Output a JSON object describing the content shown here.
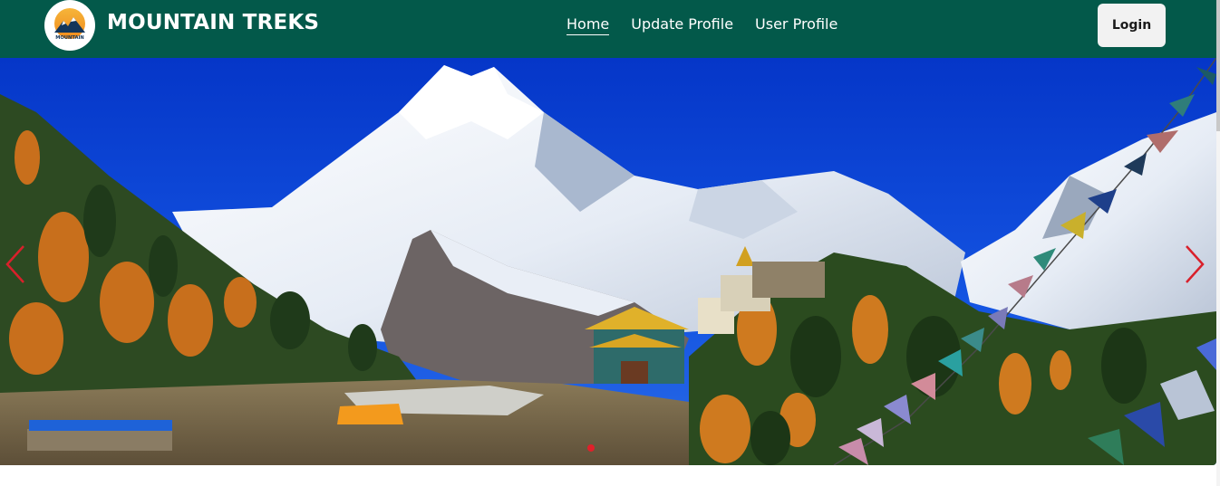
{
  "brand": {
    "name": "MOUNTAIN TREKS",
    "logo_text": "MOUNTAIN"
  },
  "nav": {
    "links": [
      {
        "label": "Home",
        "active": true
      },
      {
        "label": "Update Profile",
        "active": false
      },
      {
        "label": "User Profile",
        "active": false
      }
    ],
    "login_label": "Login"
  },
  "hero": {
    "image_icon": "mountain-landscape",
    "active_slide": 1
  },
  "colors": {
    "navbar": "#03594a",
    "sky": "#0a3fd6",
    "arrow": "#d9202b",
    "indicator": "#e0202a"
  }
}
